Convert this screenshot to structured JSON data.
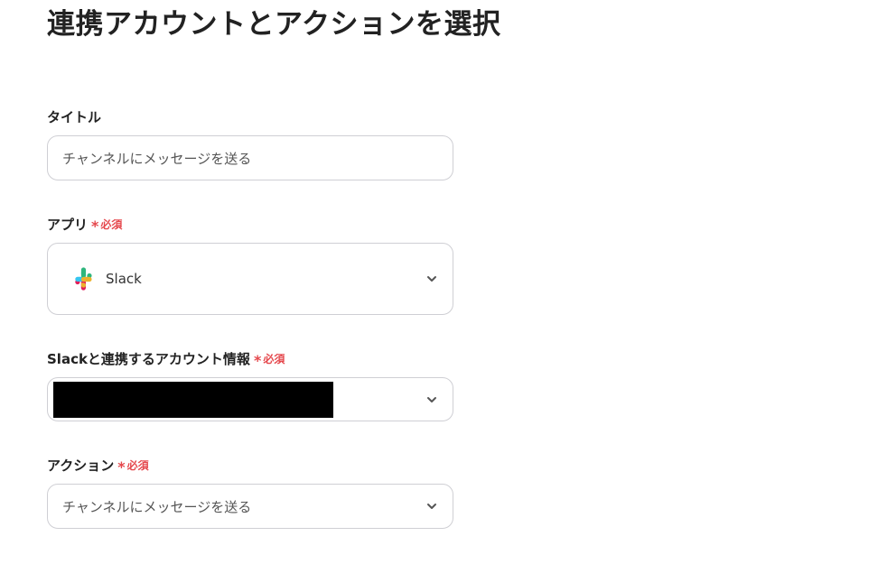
{
  "page": {
    "title": "連携アカウントとアクションを選択"
  },
  "fields": {
    "title": {
      "label": "タイトル",
      "value": "チャンネルにメッセージを送る"
    },
    "app": {
      "label": "アプリ",
      "required_mark": "*",
      "required_text": "必須",
      "selected": "Slack",
      "icon": "slack-logo-icon"
    },
    "account": {
      "label": "Slackと連携するアカウント情報",
      "required_mark": "*",
      "required_text": "必須"
    },
    "action": {
      "label": "アクション",
      "required_mark": "*",
      "required_text": "必須",
      "selected": "チャンネルにメッセージを送る"
    }
  },
  "colors": {
    "required": "#e5484d",
    "border": "#cfcfd4",
    "redaction": "#000000"
  }
}
